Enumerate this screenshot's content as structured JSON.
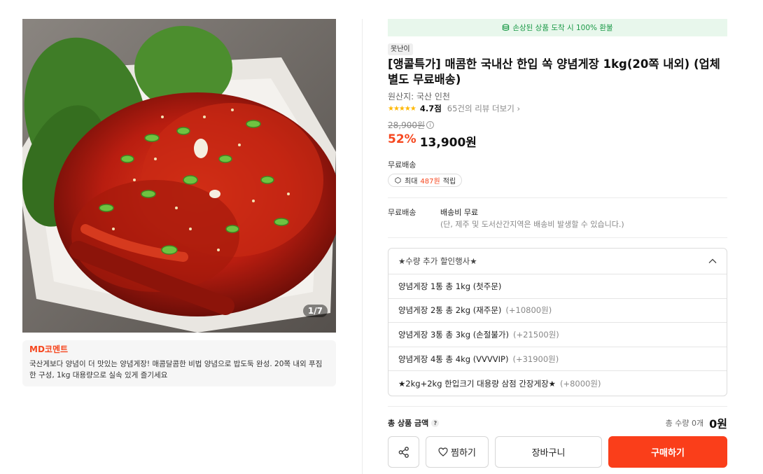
{
  "gallery": {
    "counter": "1/7"
  },
  "md_comment": {
    "title": "MD코멘트",
    "text": "국산게보다 양념이 더 맛있는 양념게장! 매콤달콤한 비법 양념으로 밥도둑 완성. 20쪽 내외 푸짐한 구성, 1kg 대용량으로 실속 있게 즐기세요"
  },
  "refund_banner": "손상된 상품 도착 시 100% 환불",
  "product": {
    "badge": "못난이",
    "title": "[앵콜특가] 매콤한 국내산 한입 쏙 양념게장 1kg(20쪽 내외) (업체별도 무료배송)",
    "origin": "원산지: 국산 인천",
    "stars": "★★★★★",
    "rating": "4.7점",
    "reviews": "65건의 리뷰 더보기 ›",
    "original_price": "28,900원",
    "discount": "52%",
    "price": "13,900원"
  },
  "shipping": {
    "label": "무료배송",
    "points_prefix": "최대",
    "points_value": "487원",
    "points_suffix": "적립"
  },
  "delivery": {
    "key": "무료배송",
    "value": "배송비 무료",
    "note": "(단, 제주 및 도서산간지역은 배송비 발생할 수 있습니다.)"
  },
  "options": {
    "header": "★수량 추가 할인행사★",
    "items": [
      {
        "label": "양념게장 1통 총 1kg (첫주문)",
        "extra": ""
      },
      {
        "label": "양념게장 2통 총 2kg (재주문)",
        "extra": "(+10800원)"
      },
      {
        "label": "양념게장 3통 총 3kg (손절불가)",
        "extra": "(+21500원)"
      },
      {
        "label": "양념게장 4통 총 4kg (VVVVIP)",
        "extra": "(+31900원)"
      },
      {
        "label": "★2kg+2kg 한입크기 대용량 삼점 간장게장★",
        "extra": "(+8000원)"
      }
    ]
  },
  "total": {
    "label": "총 상품 금액",
    "help": "?",
    "quantity": "총 수량 0개",
    "price": "0원"
  },
  "buttons": {
    "wish": "찜하기",
    "cart": "장바구니",
    "buy": "구매하기"
  },
  "colors": {
    "accent": "#fa3e1a",
    "discount": "#f6471f",
    "refund_green": "#1c9a48",
    "star": "#ffb800"
  }
}
